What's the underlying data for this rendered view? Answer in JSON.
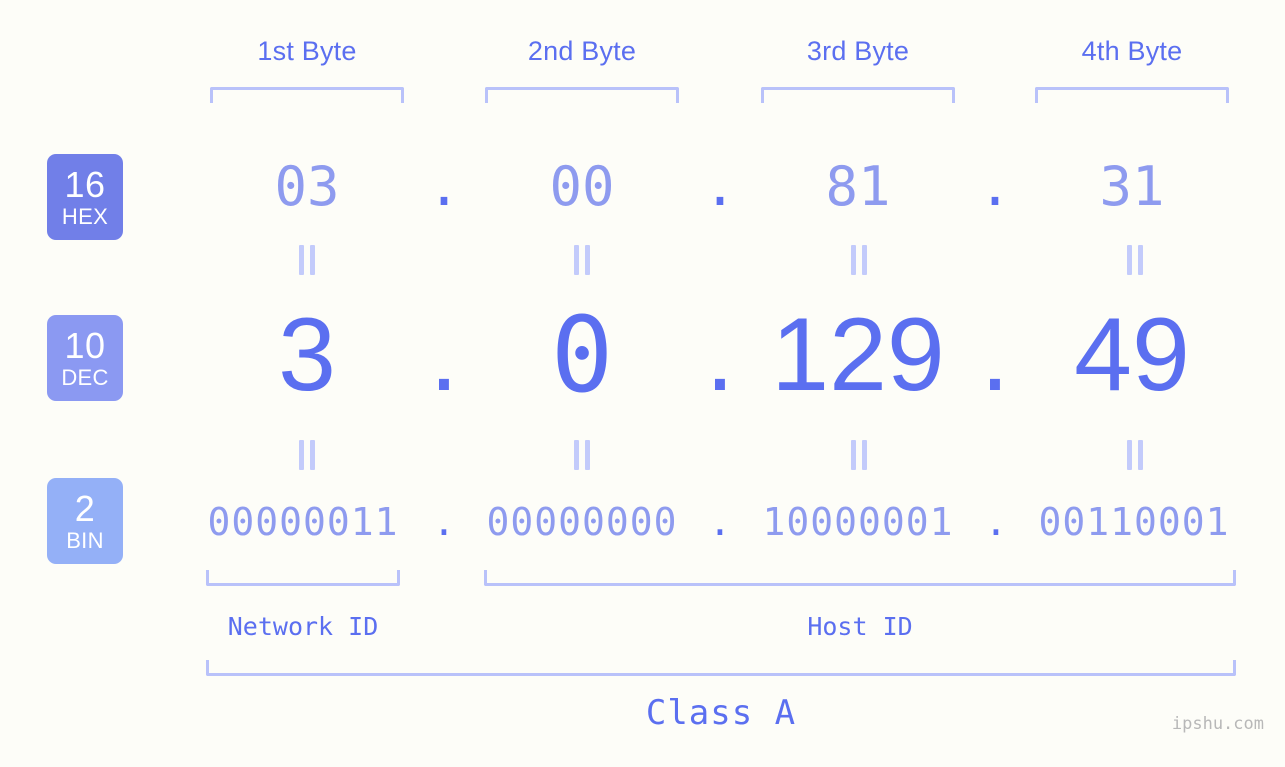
{
  "background_color": "#fdfdf8",
  "accent_color": "#5b6ff0",
  "accent_light_color": "#8e9bef",
  "bracket_color": "#b9c2fa",
  "byte_headers": [
    {
      "label": "1st Byte"
    },
    {
      "label": "2nd Byte"
    },
    {
      "label": "3rd Byte"
    },
    {
      "label": "4th Byte"
    }
  ],
  "rows": [
    {
      "badge": {
        "number": "16",
        "name": "HEX",
        "color": "#717fe8"
      },
      "values": [
        "03",
        "00",
        "81",
        "31"
      ],
      "separator": "."
    },
    {
      "badge": {
        "number": "10",
        "name": "DEC",
        "color": "#8b99f2"
      },
      "values": [
        "3",
        "0",
        "129",
        "49"
      ],
      "separator": "."
    },
    {
      "badge": {
        "number": "2",
        "name": "BIN",
        "color": "#94b0f7"
      },
      "values": [
        "00000011",
        "00000000",
        "10000001",
        "00110001"
      ],
      "separator": "."
    }
  ],
  "equals_symbol": "=",
  "sections": [
    {
      "label": "Network ID"
    },
    {
      "label": "Host ID"
    }
  ],
  "class_label": "Class A",
  "watermark": "ipshu.com"
}
